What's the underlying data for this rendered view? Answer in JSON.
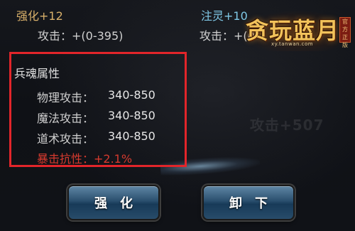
{
  "top": {
    "enhance_label": "强化+12",
    "attack_range": "攻击：+(0-395)",
    "infuse_label": "注灵+10",
    "infuse_attack": "攻击：+(0-"
  },
  "logo": {
    "title": "贪玩蓝月",
    "url": "xy.tanwan.com",
    "seal": "官方正版"
  },
  "soul_section": {
    "title": "兵魂属性",
    "stats": [
      {
        "name": "物理攻击：",
        "value": "340-850"
      },
      {
        "name": "魔法攻击：",
        "value": "340-850"
      },
      {
        "name": "道术攻击：",
        "value": "340-850"
      }
    ],
    "crit_resist": "暴击抗性：+2.1%"
  },
  "background_text": "攻击+507",
  "buttons": {
    "enhance": "强化",
    "unequip": "卸下"
  },
  "colors": {
    "highlight_border": "#e2252a",
    "gold_text": "#d8b06a",
    "cyan_text": "#7fc8e6",
    "crit_red": "#d63a2e"
  }
}
